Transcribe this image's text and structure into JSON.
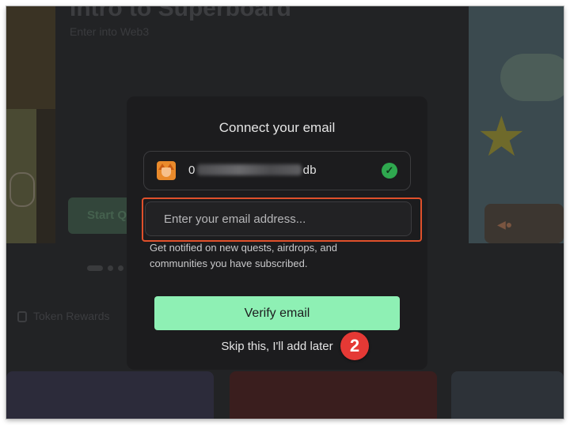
{
  "background": {
    "title": "Intro to Superboard",
    "subtitle": "Enter into Web3",
    "start_button": "Start Q",
    "token_rewards": "Token Rewards"
  },
  "modal": {
    "title": "Connect your email",
    "wallet": {
      "icon": "metamask-fox-icon",
      "address_prefix": "0",
      "address_suffix": "db",
      "status_icon": "verified-check-icon"
    },
    "email": {
      "value": "",
      "placeholder": "Enter your email address..."
    },
    "help_text": "Get notified on new quests, airdrops, and communities you have subscribed.",
    "verify_label": "Verify email",
    "skip_label": "Skip this, I'll add later"
  },
  "annotation": {
    "step_number": "2",
    "highlight_color": "#e0502b",
    "badge_color": "#e53935"
  },
  "colors": {
    "accent": "#8ef0b4",
    "modal_bg": "#1c1c1e",
    "overlay_bg": "#222325"
  }
}
